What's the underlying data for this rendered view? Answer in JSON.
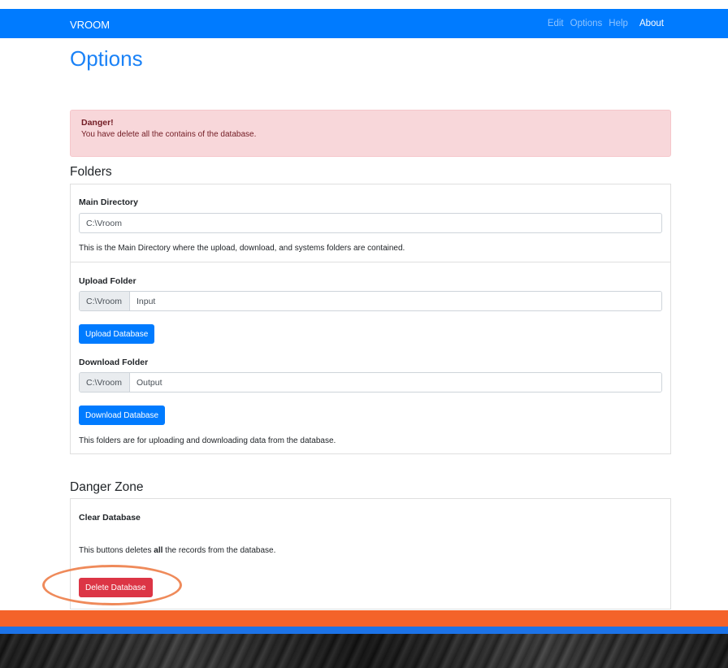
{
  "navbar": {
    "brand": "VROOM",
    "links": [
      "Edit",
      "Options",
      "Help"
    ],
    "active_link": "About"
  },
  "page": {
    "title": "Options"
  },
  "alert": {
    "heading": "Danger!",
    "message": "You have delete all the contains of the database."
  },
  "folders": {
    "title": "Folders",
    "main_directory": {
      "label": "Main Directory",
      "value": "C:\\Vroom",
      "help": "This is the Main Directory where the upload, download, and systems folders are contained."
    },
    "upload": {
      "label": "Upload Folder",
      "prefix": "C:\\Vroom",
      "value": "Input",
      "button": "Upload Database"
    },
    "download": {
      "label": "Download Folder",
      "prefix": "C:\\Vroom",
      "value": "Output",
      "button": "Download Database"
    },
    "help": "This folders are for uploading and downloading data from the database."
  },
  "danger_zone": {
    "title": "Danger Zone",
    "label": "Clear Database",
    "help_before": "This buttons deletes ",
    "help_bold": "all",
    "help_after": " the records from the database.",
    "button": "Delete Database"
  },
  "colors": {
    "primary": "#007bff",
    "danger": "#dc3545",
    "highlight": "#ef8a5a",
    "footer_orange": "#f4632a"
  }
}
